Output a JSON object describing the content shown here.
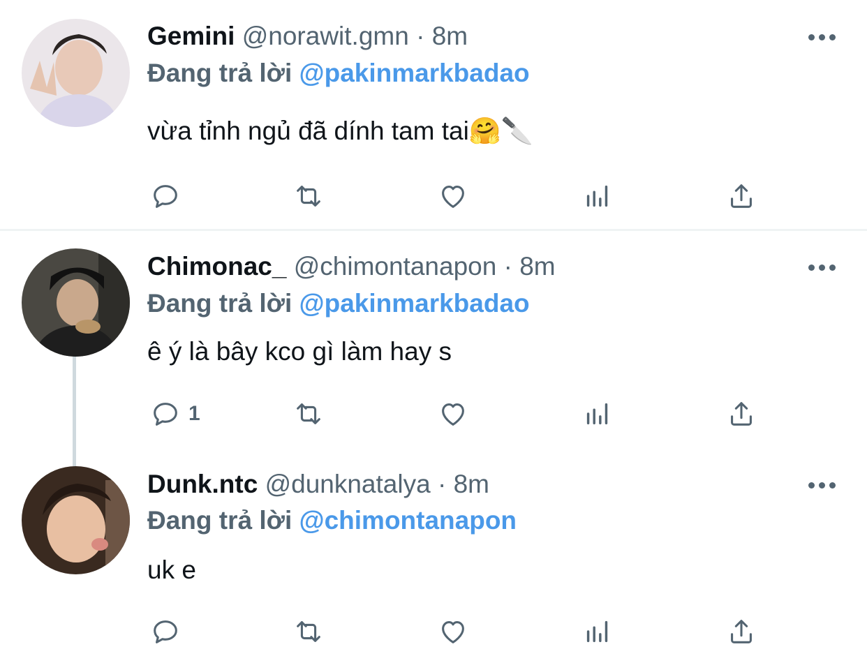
{
  "tweets": [
    {
      "name": "Gemini",
      "handle": "@norawit.gmn",
      "dot": "·",
      "time": "8m",
      "reply_prefix": "Đang trả lời",
      "reply_mention": "@pakinmarkbadao",
      "text": "vừa tỉnh ngủ đã dính tam tai🤗🔪",
      "reply_count": "",
      "avatar_colors": [
        "#e9e4ea",
        "#c9b8b2"
      ]
    },
    {
      "name": "Chimonac_",
      "handle": "@chimontanapon",
      "dot": "·",
      "time": "8m",
      "reply_prefix": "Đang trả lời",
      "reply_mention": "@pakinmarkbadao",
      "text": "ê ý là bây kco gì làm hay s",
      "reply_count": "1",
      "avatar_colors": [
        "#3c3b36",
        "#8b7f6a"
      ]
    },
    {
      "name": "Dunk.ntc",
      "handle": "@dunknatalya",
      "dot": "·",
      "time": "8m",
      "reply_prefix": "Đang trả lời",
      "reply_mention": "@chimontanapon",
      "text": "uk e",
      "reply_count": "",
      "avatar_colors": [
        "#5a4030",
        "#e3b79a"
      ]
    }
  ],
  "icons": {
    "reply": "reply-icon",
    "retweet": "retweet-icon",
    "like": "like-icon",
    "analytics": "analytics-icon",
    "share": "share-icon",
    "more": "more-icon"
  },
  "colors": {
    "accent": "#4a99e9",
    "secondary_text": "#536471",
    "primary_text": "#0f1419",
    "thread_line": "#cfd9de"
  }
}
